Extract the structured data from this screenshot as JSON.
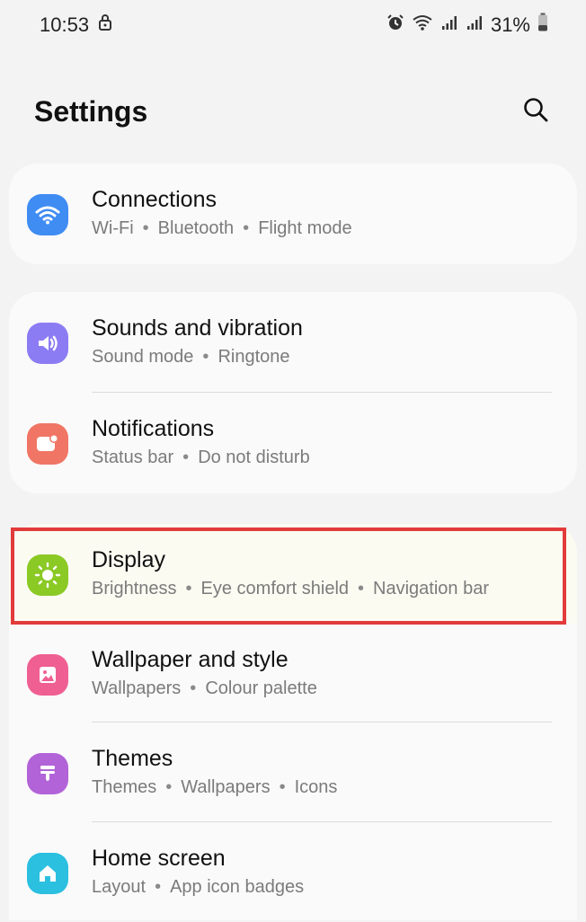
{
  "status_bar": {
    "time": "10:53",
    "battery": "31%",
    "icons": [
      "lock-icon",
      "alarm-icon",
      "wifi-icon",
      "signal-icon",
      "signal-icon",
      "battery-icon"
    ]
  },
  "header": {
    "title": "Settings",
    "search_icon": "search-icon"
  },
  "colors": {
    "connections": "#3f8cf3",
    "sounds": "#8c7cf4",
    "notifications": "#f07565",
    "display": "#8bc925",
    "wallpaper": "#ef5f92",
    "themes": "#b263d8",
    "home": "#2bbfe0",
    "highlight": "#e23b3b"
  },
  "sections": [
    {
      "items": [
        {
          "title": "Connections",
          "subs": [
            "Wi-Fi",
            "Bluetooth",
            "Flight mode"
          ],
          "icon": "wifi-icon"
        }
      ]
    },
    {
      "items": [
        {
          "title": "Sounds and vibration",
          "subs": [
            "Sound mode",
            "Ringtone"
          ],
          "icon": "speaker-icon"
        },
        {
          "title": "Notifications",
          "subs": [
            "Status bar",
            "Do not disturb"
          ],
          "icon": "notification-icon"
        }
      ]
    },
    {
      "items": [
        {
          "title": "Display",
          "subs": [
            "Brightness",
            "Eye comfort shield",
            "Navigation bar"
          ],
          "icon": "sun-icon"
        },
        {
          "title": "Wallpaper and style",
          "subs": [
            "Wallpapers",
            "Colour palette"
          ],
          "icon": "image-icon"
        },
        {
          "title": "Themes",
          "subs": [
            "Themes",
            "Wallpapers",
            "Icons"
          ],
          "icon": "brush-icon"
        },
        {
          "title": "Home screen",
          "subs": [
            "Layout",
            "App icon badges"
          ],
          "icon": "home-icon"
        }
      ]
    }
  ]
}
